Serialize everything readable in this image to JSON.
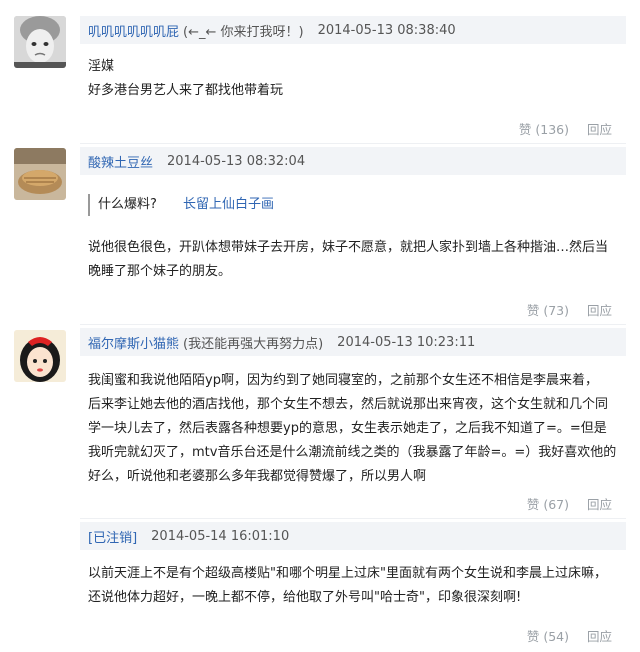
{
  "comments": [
    {
      "name": "叽叽叽叽叽叽屁",
      "note": "(←_← 你来打我呀！)",
      "time": "2014-05-13 08:38:40",
      "lines": [
        "淫媒",
        "好多港台男艺人来了都找他带着玩"
      ],
      "likes": "赞 (136)",
      "reply": "回应"
    },
    {
      "name": "酸辣土豆丝",
      "note": "",
      "time": "2014-05-13 08:32:04",
      "quote_text": "什么爆料?",
      "quote_link": "长留上仙白子画",
      "lines": [
        "说他很色很色，开趴体想带妹子去开房，妹子不愿意，就把人家扑到墙上各种揩油…然后当",
        "晚睡了那个妹子的朋友。"
      ],
      "likes": "赞 (73)",
      "reply": "回应"
    },
    {
      "name": "福尔摩斯小猫熊",
      "note": "(我还能再强大再努力点)",
      "time": "2014-05-13 10:23:11",
      "lines": [
        "我闺蜜和我说他陌陌yp啊，因为约到了她同寝室的，之前那个女生还不相信是李晨来着，",
        "后来李让她去他的酒店找他，那个女生不想去，然后就说那出来宵夜，这个女生就和几个同",
        "学一块儿去了，然后表露各种想要yp的意思，女生表示她走了，之后我不知道了=。=但是",
        "我听完就幻灭了，mtv音乐台还是什么潮流前线之类的（我暴露了年龄=。=）我好喜欢他的",
        "好么，听说他和老婆那么多年我都觉得赞爆了，所以男人啊"
      ],
      "likes": "赞 (67)",
      "reply": "回应"
    },
    {
      "name": "[已注销]",
      "note": "",
      "time": "2014-05-14 16:01:10",
      "lines": [
        "以前天涯上不是有个超级高楼贴\"和哪个明星上过床\"里面就有两个女生说和李晨上过床嘛，",
        "还说他体力超好，一晚上都不停，给他取了外号叫\"哈士奇\"，印象很深刻啊!"
      ],
      "likes": "赞 (54)",
      "reply": "回应"
    }
  ]
}
